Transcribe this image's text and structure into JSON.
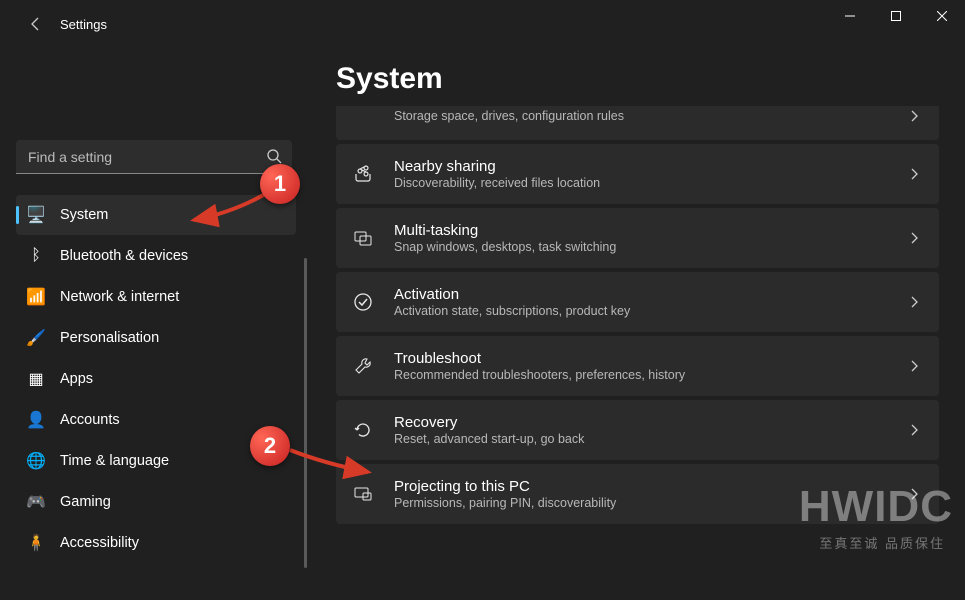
{
  "window": {
    "app_title": "Settings"
  },
  "search": {
    "placeholder": "Find a setting"
  },
  "sidebar": {
    "items": [
      {
        "icon": "display-icon",
        "glyph": "🖥️",
        "label": "System",
        "active": true
      },
      {
        "icon": "bluetooth-icon",
        "glyph": "ᛒ",
        "label": "Bluetooth & devices"
      },
      {
        "icon": "wifi-icon",
        "glyph": "📶",
        "label": "Network & internet"
      },
      {
        "icon": "brush-icon",
        "glyph": "🖌️",
        "label": "Personalisation"
      },
      {
        "icon": "apps-icon",
        "glyph": "▦",
        "label": "Apps"
      },
      {
        "icon": "account-icon",
        "glyph": "👤",
        "label": "Accounts"
      },
      {
        "icon": "time-icon",
        "glyph": "🌐",
        "label": "Time & language"
      },
      {
        "icon": "gaming-icon",
        "glyph": "🎮",
        "label": "Gaming"
      },
      {
        "icon": "accessibility-icon",
        "glyph": "🧍",
        "label": "Accessibility"
      }
    ]
  },
  "main": {
    "page_title": "System",
    "cards": [
      {
        "icon": "storage-icon",
        "title": "",
        "sub": "Storage space, drives, configuration rules",
        "partial_top": true
      },
      {
        "icon": "share-icon",
        "title": "Nearby sharing",
        "sub": "Discoverability, received files location"
      },
      {
        "icon": "multitask-icon",
        "title": "Multi-tasking",
        "sub": "Snap windows, desktops, task switching"
      },
      {
        "icon": "activation-icon",
        "title": "Activation",
        "sub": "Activation state, subscriptions, product key"
      },
      {
        "icon": "troubleshoot-icon",
        "title": "Troubleshoot",
        "sub": "Recommended troubleshooters, preferences, history"
      },
      {
        "icon": "recovery-icon",
        "title": "Recovery",
        "sub": "Reset, advanced start-up, go back"
      },
      {
        "icon": "project-icon",
        "title": "Projecting to this PC",
        "sub": "Permissions, pairing PIN, discoverability"
      }
    ]
  },
  "annotations": {
    "badge1": "1",
    "badge2": "2"
  },
  "watermark": {
    "main": "HWIDC",
    "sub": "至真至诚  品质保住"
  }
}
